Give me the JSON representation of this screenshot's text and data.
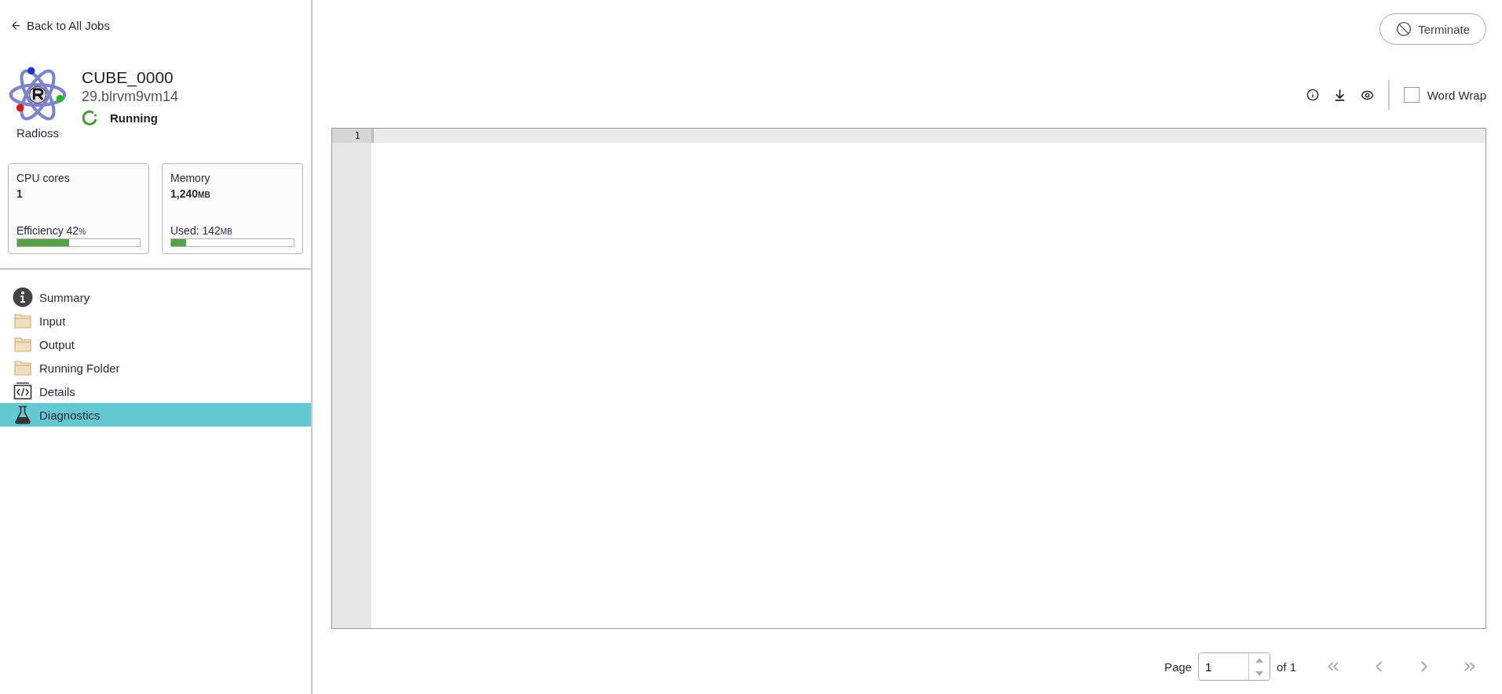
{
  "back_link": "Back to All Jobs",
  "job": {
    "app": "Radioss",
    "name": "CUBE_0000",
    "id": "29.blrvm9vm14",
    "status": "Running"
  },
  "cards": [
    {
      "title": "CPU cores",
      "value": "1",
      "meter_label": "Efficiency",
      "meter_value": "42",
      "meter_unit": "%",
      "level": 0.42
    },
    {
      "title": "Memory",
      "value": "1,240",
      "value_unit": "MB",
      "meter_label": "Used:",
      "meter_value": "142",
      "meter_unit": "MB",
      "level": 0.12
    }
  ],
  "nav": [
    {
      "label": "Summary",
      "kind": "info",
      "selected": false
    },
    {
      "label": "Input",
      "kind": "folder",
      "selected": false
    },
    {
      "label": "Output",
      "kind": "folder",
      "selected": false
    },
    {
      "label": "Running Folder",
      "kind": "folder",
      "selected": false
    },
    {
      "label": "Details",
      "kind": "code",
      "selected": false
    },
    {
      "label": "Diagnostics",
      "kind": "flask",
      "selected": true
    }
  ],
  "terminate": "Terminate",
  "toolbar": {
    "word_wrap": {
      "label": "Word Wrap",
      "checked": false
    }
  },
  "editor": {
    "lines": [
      {
        "number": "1",
        "current": true
      }
    ]
  },
  "pagination": {
    "label": "Page",
    "value": "1",
    "of": "of 1",
    "first_disabled": true,
    "prev_disabled": true,
    "next_disabled": true,
    "last_disabled": true
  }
}
